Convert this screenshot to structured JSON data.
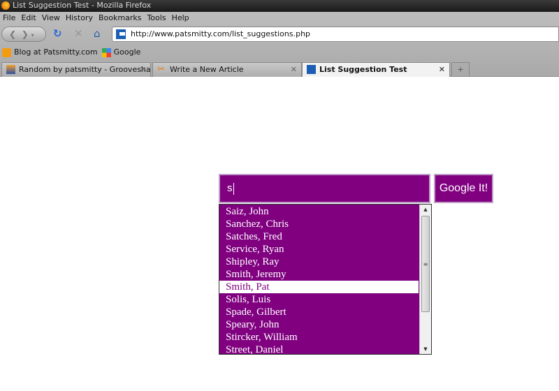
{
  "window": {
    "title": "List Suggestion Test - Mozilla Firefox"
  },
  "menu": [
    "File",
    "Edit",
    "View",
    "History",
    "Bookmarks",
    "Tools",
    "Help"
  ],
  "navbar": {
    "url": "http://www.patsmitty.com/list_suggestions.php"
  },
  "bookmarks": [
    {
      "label": "Blog at Patsmitty.com",
      "icon": "rss-icon"
    },
    {
      "label": "Google",
      "icon": "google-icon"
    }
  ],
  "tabs": [
    {
      "label": "Random by patsmitty - Grooveshar...",
      "active": false
    },
    {
      "label": "Write a New Article",
      "active": false
    },
    {
      "label": "List Suggestion Test",
      "active": true
    }
  ],
  "page": {
    "search_value": "s",
    "button_label": "Google It!",
    "accent": "#800080",
    "suggestions": [
      "Saiz, John",
      "Sanchez, Chris",
      "Satches, Fred",
      "Service, Ryan",
      "Shipley, Ray",
      "Smith, Jeremy",
      "Smith, Pat",
      "Solis, Luis",
      "Spade, Gilbert",
      "Speary, John",
      "Stircker, William",
      "Street, Daniel"
    ],
    "selected_index": 6
  }
}
